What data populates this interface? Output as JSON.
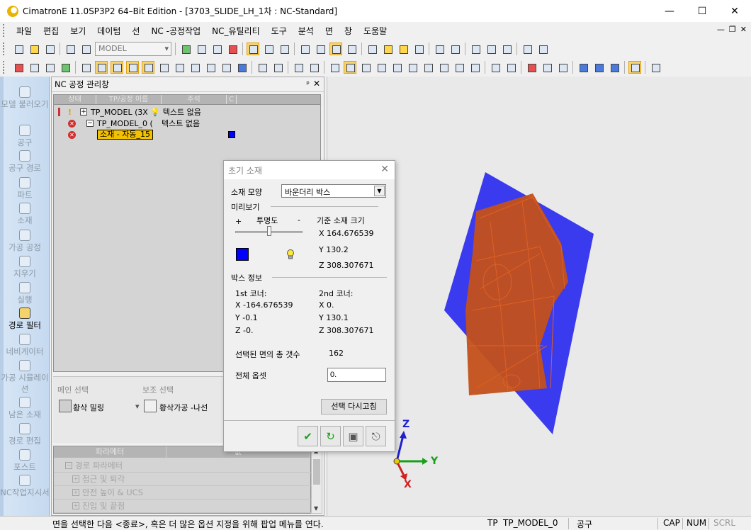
{
  "window": {
    "title": "CimatronE 11.0SP3P2 64–Bit Edition - [3703_SLIDE_LH_1차 : NC-Standard]",
    "controls": {
      "minimize": "—",
      "maximize": "☐",
      "close": "✕"
    }
  },
  "menu": [
    "파일",
    "편집",
    "보기",
    "데이텀",
    "선",
    "NC -공정작업",
    "NC_유틸리티",
    "도구",
    "분석",
    "면",
    "창",
    "도움말"
  ],
  "mdi_controls": {
    "minimize": "—",
    "restore": "❐",
    "close": "✕"
  },
  "toolbar": {
    "model_combo": "MODEL"
  },
  "sidebar": {
    "items": [
      {
        "label": "모델 불러오기",
        "icon": "import-icon"
      },
      {
        "label": "공구",
        "icon": "tool-icon"
      },
      {
        "label": "공구 경로",
        "icon": "toolpath-icon"
      },
      {
        "label": "파트",
        "icon": "part-icon"
      },
      {
        "label": "소재",
        "icon": "stock-icon"
      },
      {
        "label": "가공 공정",
        "icon": "process-icon"
      },
      {
        "label": "지우기",
        "icon": "erase-icon"
      },
      {
        "label": "실행",
        "icon": "execute-icon"
      },
      {
        "label": "경로 필터",
        "icon": "filter-icon"
      },
      {
        "label": "네비게이터",
        "icon": "navigator-icon"
      },
      {
        "label": "가공 시뮬레이션",
        "icon": "simulation-icon"
      },
      {
        "label": "남은 소재",
        "icon": "remaining-stock-icon"
      },
      {
        "label": "경로 편집",
        "icon": "edit-path-icon"
      },
      {
        "label": "포스트",
        "icon": "post-icon"
      },
      {
        "label": "NC작업지시서",
        "icon": "nc-sheet-icon"
      }
    ]
  },
  "nc_panel": {
    "title": "NC 공정 관리창",
    "pin": "ᵖ",
    "close": "✕",
    "columns": [
      "상태",
      "TP/공정 이름",
      "주석",
      "C"
    ],
    "rows": [
      {
        "name": "TP_MODEL (3X",
        "comment": "텍스트 없음",
        "expand": "+"
      },
      {
        "name": "TP_MODEL_0 (",
        "comment": "텍스트 없음",
        "expand": "−"
      },
      {
        "name": "소재 - 자동_15"
      }
    ],
    "main_select_label": "메인 선택",
    "sub_select_label": "보조 선택",
    "main_select_value": "황삭 밀링",
    "sub_select_value": "황삭가공 -나선",
    "param_columns": [
      "파라메터",
      "값"
    ],
    "params": [
      "경로 파라메터",
      "접근 및 퇴각",
      "안전 높이 & UCS",
      "진입 및 끝점"
    ]
  },
  "dialog": {
    "title": "초기 소재",
    "shape_label": "소재 모양",
    "shape_value": "바운더리 박스",
    "preview_label": "미리보기",
    "plus": "+",
    "transparency_label": "투명도",
    "minus": "-",
    "ref_size_label": "기준 소재 크기",
    "ref_x": "X 164.676539",
    "ref_y": "Y 130.2",
    "ref_z": "Z 308.307671",
    "box_info_label": "박스 정보",
    "corner1_label": "1st 코너:",
    "corner2_label": "2nd 코너:",
    "c1_x": "X -164.676539",
    "c1_y": "Y -0.1",
    "c1_z": "Z -0.",
    "c2_x": "X 0.",
    "c2_y": "Y 130.1",
    "c2_z": "Z 308.307671",
    "faces_label": "선택된 면의 총 갯수",
    "faces_count": "162",
    "offset_label": "전체 옵셋",
    "offset_value": "0.",
    "reselect_label": "선택 다시고침",
    "preview_color": "#0000ff"
  },
  "axis": {
    "x": "X",
    "y": "Y",
    "z": "Z"
  },
  "status": {
    "message": "면을 선택한 다음 <종료>, 혹은 더 많은 옵션 지정을 위해 팝업 메뉴를 연다.",
    "mode": "TP",
    "tp_name": "TP_MODEL_0",
    "tool": "공구",
    "cap": "CAP",
    "num": "NUM",
    "scrl": "SCRL"
  }
}
